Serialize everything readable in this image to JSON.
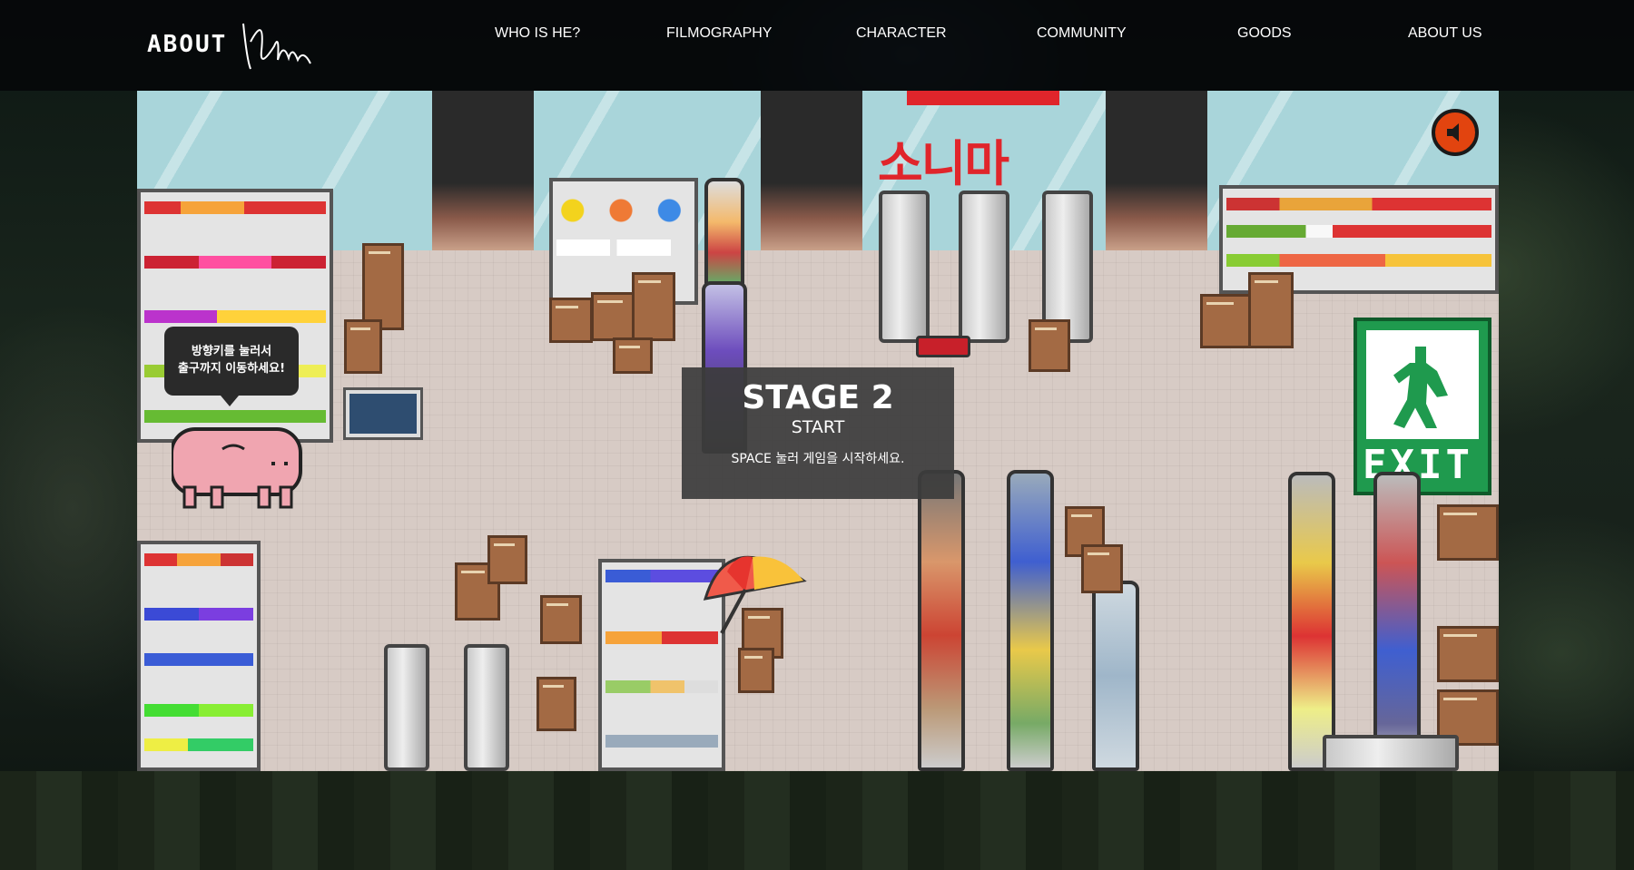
{
  "header": {
    "logo": "ABOUT",
    "signature_icon": "signature-icon",
    "nav": [
      {
        "label": "WHO IS HE?"
      },
      {
        "label": "FILMOGRAPHY"
      },
      {
        "label": "CHARACTER"
      },
      {
        "label": "COMMUNITY"
      },
      {
        "label": "GOODS"
      },
      {
        "label": "ABOUT US"
      }
    ]
  },
  "game": {
    "store_sign": "소니마",
    "exit_sign": "EXIT",
    "speech_bubble": {
      "line1": "방향키를 눌러서",
      "line2": "출구까지 이동하세요!"
    },
    "overlay": {
      "stage": "STAGE 2",
      "start": "START",
      "hint": "SPACE 눌러 게임을 시작하세요."
    },
    "sound_icon": "speaker-icon"
  },
  "colors": {
    "header_bg": "#05080a",
    "sign_red": "#e0252b",
    "exit_green": "#1f9a4e",
    "floor": "#d7cbc5",
    "sound_button": "#e2440f"
  }
}
